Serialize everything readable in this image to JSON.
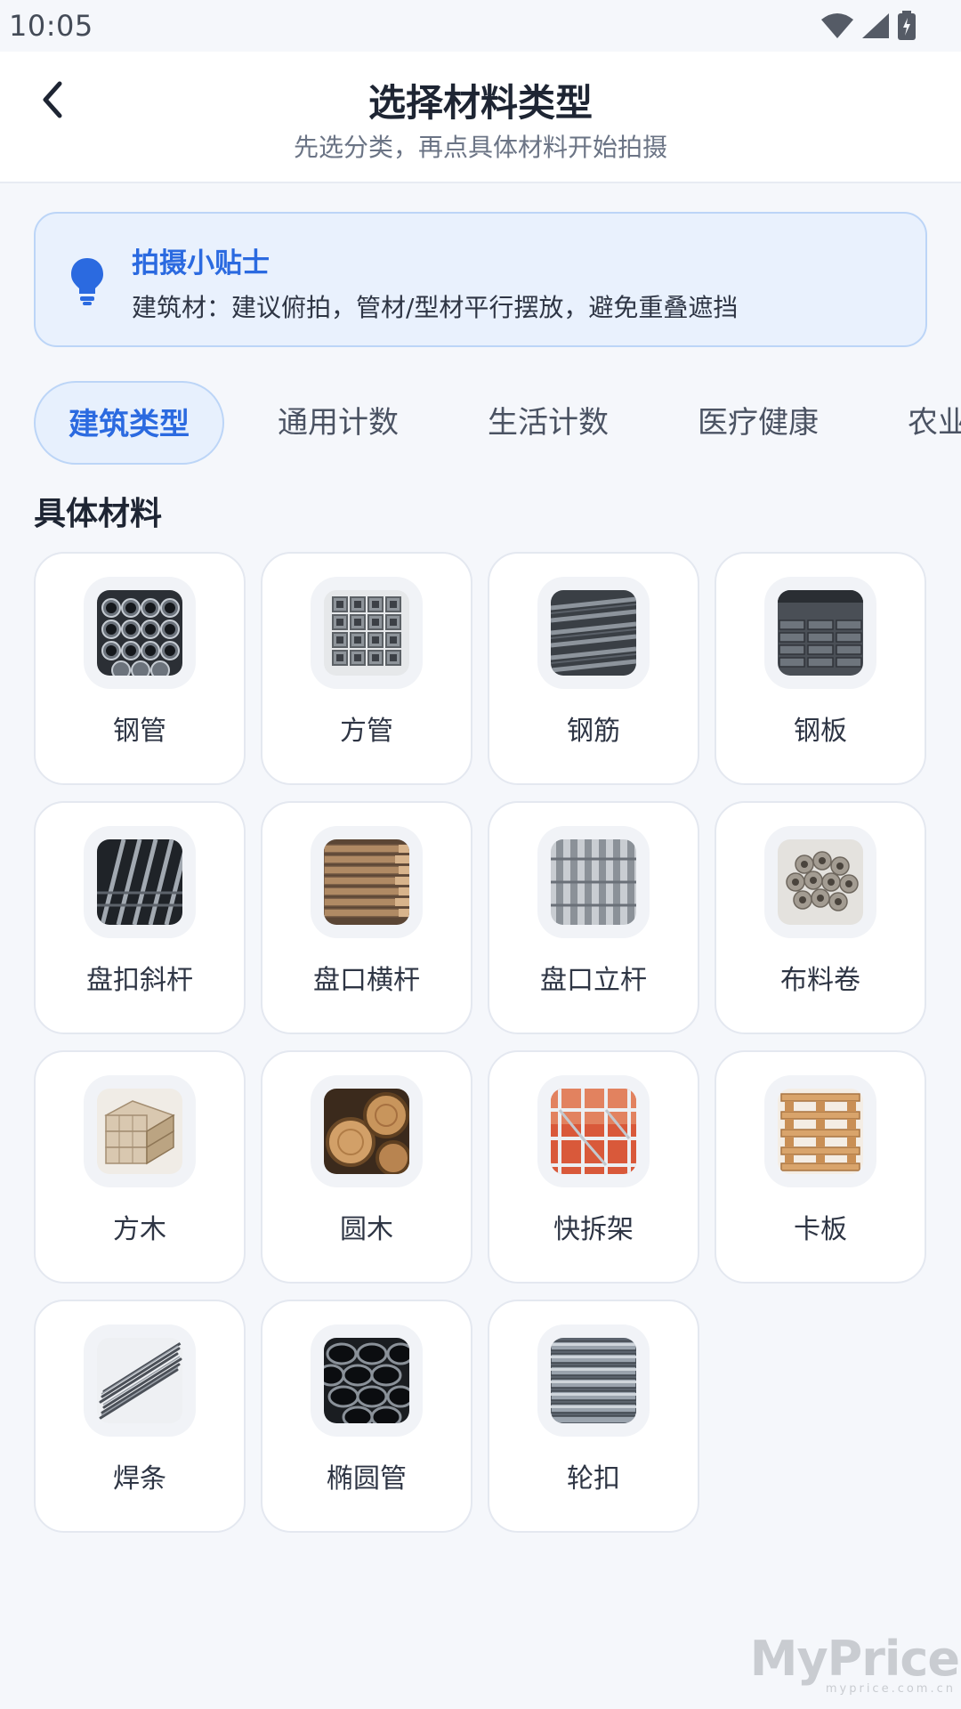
{
  "status_bar": {
    "time": "10:05"
  },
  "header": {
    "title": "选择材料类型",
    "subtitle": "先选分类，再点具体材料开始拍摄"
  },
  "tip": {
    "icon": "lightbulb-icon",
    "title": "拍摄小贴士",
    "text": "建筑材：建议俯拍，管材/型材平行摆放，避免重叠遮挡"
  },
  "tabs": [
    {
      "label": "建筑类型",
      "active": true
    },
    {
      "label": "通用计数",
      "active": false
    },
    {
      "label": "生活计数",
      "active": false
    },
    {
      "label": "医疗健康",
      "active": false
    },
    {
      "label": "农业",
      "active": false
    }
  ],
  "section_title": "具体材料",
  "materials": [
    {
      "label": "钢管",
      "icon": "steel-pipe-image"
    },
    {
      "label": "方管",
      "icon": "square-tube-image"
    },
    {
      "label": "钢筋",
      "icon": "rebar-image"
    },
    {
      "label": "钢板",
      "icon": "steel-plate-image"
    },
    {
      "label": "盘扣斜杆",
      "icon": "diagonal-bar-image"
    },
    {
      "label": "盘口横杆",
      "icon": "horizontal-bar-image"
    },
    {
      "label": "盘口立杆",
      "icon": "vertical-bar-image"
    },
    {
      "label": "布料卷",
      "icon": "fabric-roll-image"
    },
    {
      "label": "方木",
      "icon": "square-timber-image"
    },
    {
      "label": "圆木",
      "icon": "round-log-image"
    },
    {
      "label": "快拆架",
      "icon": "scaffold-image"
    },
    {
      "label": "卡板",
      "icon": "pallet-image"
    },
    {
      "label": "焊条",
      "icon": "welding-rod-image"
    },
    {
      "label": "椭圆管",
      "icon": "oval-tube-image"
    },
    {
      "label": "轮扣",
      "icon": "ring-lock-image"
    }
  ],
  "watermark": {
    "main": "MyPrice",
    "sub": "myprice.com.cn"
  },
  "colors": {
    "accent": "#2b6ae0",
    "tip_bg": "#e9f1fd",
    "page_bg": "#f5f7fb"
  }
}
